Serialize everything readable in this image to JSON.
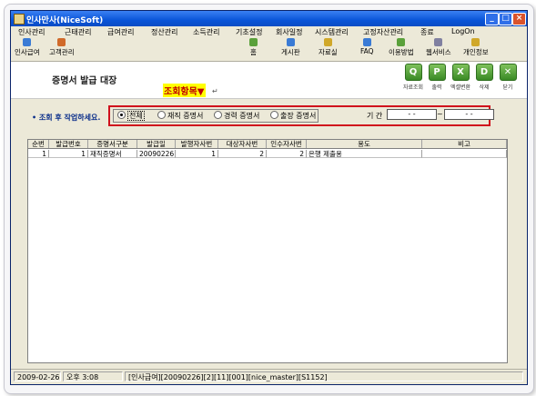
{
  "window": {
    "title": "인사만사(NiceSoft)",
    "controls": {
      "minimize": "_",
      "maximize": "□",
      "close": "×"
    }
  },
  "menu": [
    "인사관리",
    "근태관리",
    "급여관리",
    "정산관리",
    "소득관리",
    "기초설정",
    "회사일정",
    "시스템관리",
    "고정자산관리",
    "종료",
    "LogOn"
  ],
  "toolbar": {
    "left": [
      {
        "label": "인사급여",
        "icon": "hr-payroll-icon",
        "color": "#3a7bd5"
      },
      {
        "label": "고객관리",
        "icon": "customer-icon",
        "color": "#d06a2a"
      }
    ],
    "right": [
      {
        "label": "홈",
        "icon": "home-icon",
        "color": "#5aa03a"
      },
      {
        "label": "게시판",
        "icon": "board-icon",
        "color": "#3a7bd5"
      },
      {
        "label": "자료실",
        "icon": "archive-icon",
        "color": "#d0a82a"
      },
      {
        "label": "FAQ",
        "icon": "faq-icon",
        "color": "#3a7bd5"
      },
      {
        "label": "이용방법",
        "icon": "usage-icon",
        "color": "#5aa03a"
      },
      {
        "label": "웹서비스",
        "icon": "web-service-icon",
        "color": "#8080a0"
      },
      {
        "label": "개인정보",
        "icon": "privacy-icon",
        "color": "#d0a82a"
      }
    ]
  },
  "header": {
    "title": "증명서 발급 대장",
    "annotation": "조회항목▼",
    "annotation_mark": "↵",
    "actions": [
      {
        "label": "자료조회",
        "icon": "search-icon",
        "glyph": "Q"
      },
      {
        "label": "출력",
        "icon": "print-icon",
        "glyph": "P"
      },
      {
        "label": "엑셀변환",
        "icon": "excel-icon",
        "glyph": "X"
      },
      {
        "label": "삭제",
        "icon": "trash-icon",
        "glyph": "D"
      },
      {
        "label": "닫기",
        "icon": "close-icon",
        "glyph": "✕"
      }
    ]
  },
  "filter": {
    "prompt": "• 조회 후 작업하세요.",
    "options": [
      "전체",
      "재직 증명서",
      "경력 증명서",
      "출장 증명서"
    ],
    "selected": "전체",
    "period_label": "기  간",
    "date_from": "- -",
    "date_to": "- -",
    "range_sep": "~"
  },
  "grid": {
    "columns": [
      "순번",
      "발급번호",
      "증명서구분",
      "발급일",
      "발행자사번",
      "대상자사번",
      "인수자사번",
      "용도",
      "비고"
    ],
    "rows": [
      [
        "1",
        "1",
        "재직증명서",
        "20090226",
        "1",
        "2",
        "2",
        "은행 제출용",
        ""
      ]
    ]
  },
  "status": [
    "2009-02-26",
    "오후 3:08",
    "[인사급여][20090226][2][11][001][nice_master][S1152]"
  ]
}
